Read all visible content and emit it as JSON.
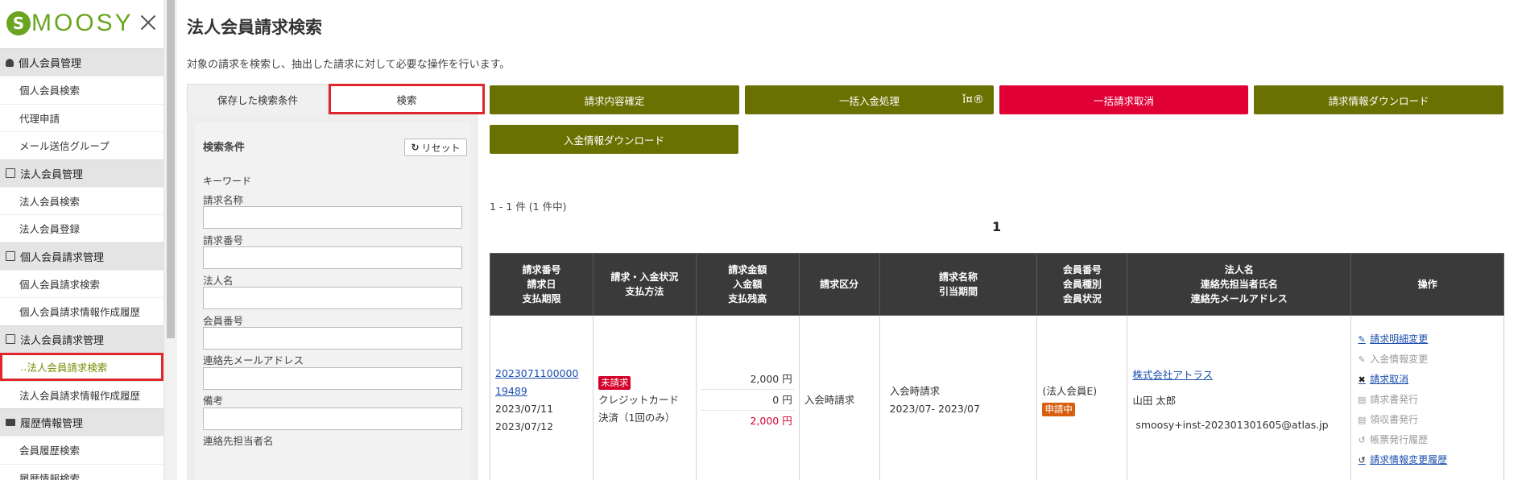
{
  "app": {
    "logo_initial": "S",
    "logo_rest": "MOOSY"
  },
  "sidebar": {
    "sections": [
      {
        "title": "個人会員管理",
        "icon": "person-icon",
        "items": [
          "個人会員検索",
          "代理申請",
          "メール送信グループ"
        ]
      },
      {
        "title": "法人会員管理",
        "icon": "building-icon",
        "items": [
          "法人会員検索",
          "法人会員登録"
        ]
      },
      {
        "title": "個人会員請求管理",
        "icon": "document-icon",
        "items": [
          "個人会員請求検索",
          "個人会員請求情報作成履歴"
        ]
      },
      {
        "title": "法人会員請求管理",
        "icon": "document-icon",
        "items": [
          "法人会員請求検索",
          "法人会員請求情報作成履歴"
        ]
      },
      {
        "title": "履歴情報管理",
        "icon": "folder-icon",
        "items": [
          "会員履歴検索",
          "履歴情報検索"
        ]
      }
    ],
    "active_item_prefix": "‥"
  },
  "page": {
    "title": "法人会員請求検索",
    "description": "対象の請求を検索し、抽出した請求に対して必要な操作を行います。"
  },
  "search_panel": {
    "tabs": {
      "saved": "保存した検索条件",
      "search": "検索"
    },
    "title": "検索条件",
    "reset_label": "リセット",
    "reset_glyph": "↻",
    "keyword_label": "キーワード",
    "fields": [
      "請求名称",
      "請求番号",
      "法人名",
      "会員番号",
      "連絡先メールアドレス",
      "備考",
      "連絡先担当者名"
    ]
  },
  "actions": {
    "confirm": "請求内容確定",
    "batch_payment": "一括入金処理",
    "batch_glyph": "ǐ¤®",
    "batch_cancel": "一括請求取消",
    "download_billing": "請求情報ダウンロード",
    "download_payment": "入金情報ダウンロード"
  },
  "colors": {
    "action_olive": "#6b7100",
    "danger": "#e00034",
    "highlight": "#e0262c",
    "brand_green": "#6aa421"
  },
  "results": {
    "count_text": "1 - 1 件 (1 件中)",
    "pages": [
      "1"
    ],
    "columns": [
      [
        "請求番号",
        "請求日",
        "支払期限"
      ],
      [
        "請求・入金状況",
        "支払方法"
      ],
      [
        "請求金額",
        "入金額",
        "支払残高"
      ],
      [
        "請求区分"
      ],
      [
        "請求名称",
        "引当期間"
      ],
      [
        "会員番号",
        "会員種別",
        "会員状況"
      ],
      [
        "法人名",
        "連絡先担当者氏名",
        "連絡先メールアドレス"
      ],
      [
        "操作"
      ]
    ],
    "rows": [
      {
        "invoice_no_line1": "2023071100000",
        "invoice_no_line2": "19489",
        "invoice_date": "2023/07/11",
        "due_date": "2023/07/12",
        "status_badge": "未請求",
        "payment_method_1": "クレジットカード",
        "payment_method_2": "決済（1回のみ）",
        "billed_amount": "2,000 円",
        "paid_amount": "0 円",
        "balance": "2,000 円",
        "category": "入会時請求",
        "billing_name": "入会時請求",
        "period": "2023/07- 2023/07",
        "member_type": "(法人会員E)",
        "member_status": "申請中",
        "company": "株式会社アトラス",
        "contact_name": "山田 太郎",
        "contact_email": "smoosy+inst-202301301605@atlas.jp",
        "operations": [
          {
            "label": "請求明細変更",
            "enabled": true,
            "icon": "pencil-icon",
            "glyph": "✎"
          },
          {
            "label": "入金情報変更",
            "enabled": false,
            "icon": "pencil-icon",
            "glyph": "✎"
          },
          {
            "label": "請求取消",
            "enabled": true,
            "icon": "x-icon",
            "glyph": "✖"
          },
          {
            "label": "請求書発行",
            "enabled": false,
            "icon": "document-icon",
            "glyph": "▤"
          },
          {
            "label": "領収書発行",
            "enabled": false,
            "icon": "document-icon",
            "glyph": "▤"
          },
          {
            "label": "帳票発行履歴",
            "enabled": false,
            "icon": "history-icon",
            "glyph": "↺"
          },
          {
            "label": "請求情報変更履歴",
            "enabled": true,
            "icon": "history-icon",
            "glyph": "↺"
          }
        ]
      }
    ]
  }
}
